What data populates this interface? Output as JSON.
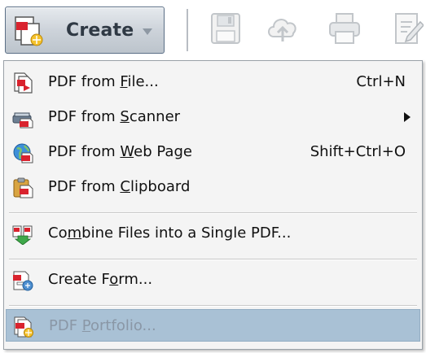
{
  "toolbar": {
    "create_label": "Create",
    "icons": [
      "create-pdf-icon",
      "save-icon",
      "cloud-upload-icon",
      "print-icon",
      "edit-icon"
    ]
  },
  "menu": {
    "items": [
      {
        "pre": "PDF from ",
        "key": "F",
        "post": "ile...",
        "shortcut": "Ctrl+N",
        "icon": "pdf-from-file-icon"
      },
      {
        "pre": "PDF from ",
        "key": "S",
        "post": "canner",
        "submenu": true,
        "icon": "pdf-from-scanner-icon"
      },
      {
        "pre": "PDF from ",
        "key": "W",
        "post": "eb Page",
        "shortcut": "Shift+Ctrl+O",
        "icon": "pdf-from-web-icon"
      },
      {
        "pre": "PDF from ",
        "key": "C",
        "post": "lipboard",
        "icon": "pdf-from-clipboard-icon"
      },
      {
        "pre": "Co",
        "key": "m",
        "post": "bine Files into a Single PDF...",
        "icon": "combine-files-icon"
      },
      {
        "pre": "Create F",
        "key": "o",
        "post": "rm...",
        "icon": "create-form-icon"
      },
      {
        "pre": "PDF ",
        "key": "P",
        "post": "ortfolio...",
        "icon": "pdf-portfolio-icon",
        "state": "highlighted-disabled"
      }
    ]
  },
  "colors": {
    "menu_background": "#f4f4f4",
    "highlight": "#a9c1d5",
    "disabled_text": "#8a97a6",
    "pdf_red": "#d9232e"
  }
}
